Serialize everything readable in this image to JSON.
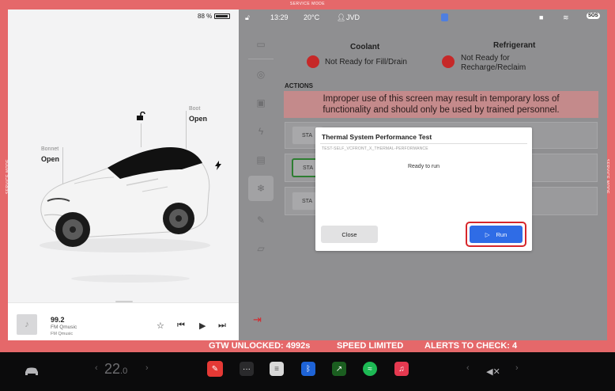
{
  "service_mode": {
    "top_label": "SERVICE MODE",
    "side_label": "SERVICE MODE"
  },
  "status_bar": {
    "battery_percent": "88 %",
    "time": "13:29",
    "temperature": "20°C",
    "profile_name": "JVD",
    "sos_label": "SOS"
  },
  "car_panel": {
    "boot_label": "Boot",
    "boot_state": "Open",
    "bonnet_label": "Bonnet",
    "bonnet_state": "Open"
  },
  "media": {
    "station": "99.2",
    "station_name": "FM Qmusic",
    "source": "FM Qmusic"
  },
  "service_panel": {
    "coolant_heading": "Coolant",
    "coolant_status": "Not Ready for Fill/Drain",
    "refrigerant_heading": "Refrigerant",
    "refrigerant_status_line1": "Not Ready for",
    "refrigerant_status_line2": "Recharge/Reclaim",
    "status_color": "#c62828",
    "actions_label": "ACTIONS",
    "warning_line1": "Improper use of this screen may result in temporary loss of",
    "warning_line2": "functionality and should only be used by trained personnel.",
    "start_label": "STA"
  },
  "modal": {
    "title": "Thermal System Performance Test",
    "subtitle": "TEST-SELF_VCFRONT_X_THERMAL-PERFORMANCE",
    "message": "Ready to run",
    "close_label": "Close",
    "run_label": "Run",
    "run_color": "#2f6ce6"
  },
  "banner": {
    "gtw": "GTW UNLOCKED: 4992s",
    "speed": "SPEED LIMITED",
    "alerts": "ALERTS TO CHECK: 4"
  },
  "taskbar": {
    "cabin_temp": "22",
    "cabin_temp_decimal": ".0",
    "apps": [
      "car-icon",
      "service-wrench-icon",
      "more-icon",
      "notepad-icon",
      "bluetooth-icon",
      "stocks-icon",
      "spotify-icon",
      "music-icon",
      "volume-mute-icon"
    ]
  }
}
